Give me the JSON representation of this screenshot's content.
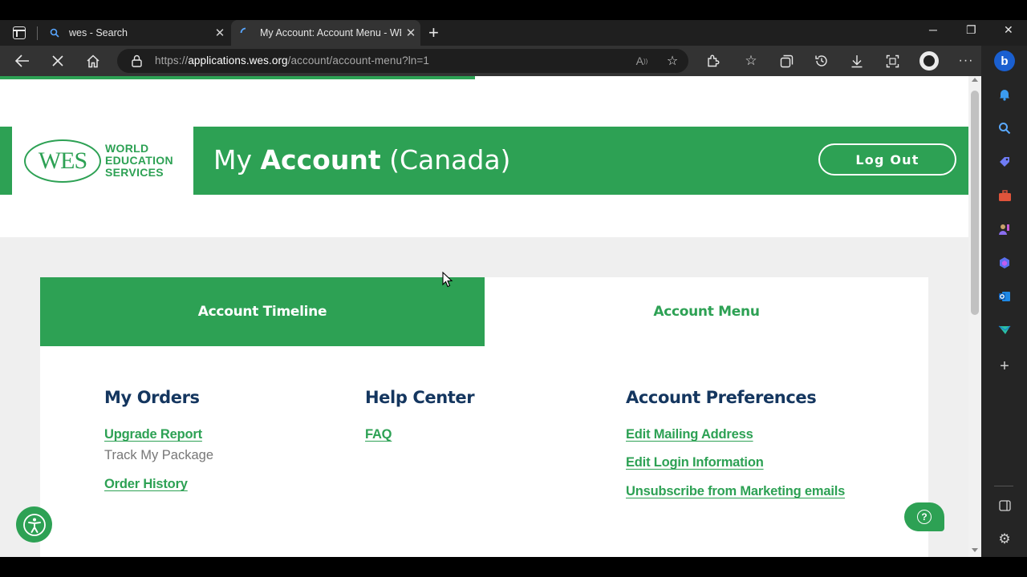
{
  "browser": {
    "tabs": [
      {
        "title": "wes - Search",
        "favicon": "search-icon"
      },
      {
        "title": "My Account: Account Menu - WES",
        "favicon": "loading-icon"
      }
    ],
    "new_tab": "+",
    "url_prefix": "https://",
    "url_host": "applications.wes.org",
    "url_path": "/account/account-menu?ln=1",
    "window_controls": {
      "minimize": "─",
      "restore": "❐",
      "close": "✕"
    }
  },
  "logo": {
    "mark": "WES",
    "words": [
      "WORLD",
      "EDUCATION",
      "SERVICES"
    ]
  },
  "header": {
    "title_prefix": "My ",
    "title_bold": "Account",
    "title_suffix": " (Canada)",
    "logout_label": "Log Out"
  },
  "tabs": {
    "timeline": "Account Timeline",
    "menu": "Account Menu"
  },
  "columns": {
    "orders": {
      "heading": "My Orders",
      "upgrade_report": "Upgrade Report",
      "track_package": "Track My Package",
      "order_history": "Order History"
    },
    "help": {
      "heading": "Help Center",
      "faq": "FAQ"
    },
    "preferences": {
      "heading": "Account Preferences",
      "edit_mailing": "Edit Mailing Address",
      "edit_login": "Edit Login Information",
      "unsubscribe": "Unsubscribe from Marketing emails"
    }
  },
  "colors": {
    "brand_green": "#2da154",
    "heading_navy": "#14365f"
  }
}
